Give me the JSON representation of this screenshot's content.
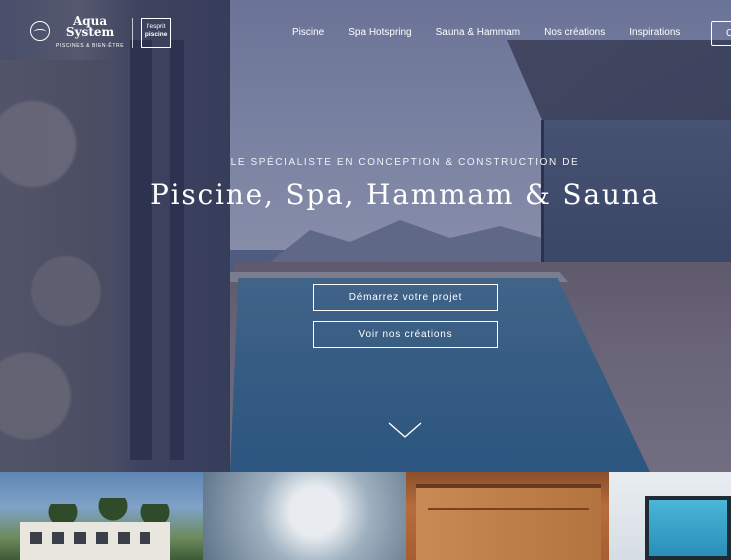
{
  "brand": {
    "name_line1": "Aqua",
    "name_line2": "System",
    "tagline": "PISCINES & BIEN-ÊTRE",
    "partner_line1": "l'esprit",
    "partner_line2": "piscine"
  },
  "nav": {
    "items": [
      "Piscine",
      "Spa Hotspring",
      "Sauna & Hammam",
      "Nos créations",
      "Inspirations"
    ],
    "cta_label": "C"
  },
  "hero": {
    "eyebrow": "Le spécialiste en conception & construction de",
    "headline": "Piscine, Spa, Hammam & Sauna",
    "primary_button": "Démarrez votre projet",
    "secondary_button": "Voir nos créations"
  },
  "icons": {
    "scroll": "chevron-down-icon",
    "logo": "wave-circle-icon"
  },
  "colors": {
    "overlay": "#283260",
    "text": "#ffffff"
  }
}
